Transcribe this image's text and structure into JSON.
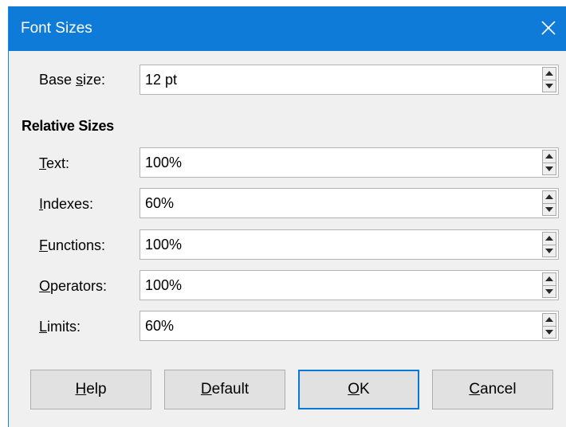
{
  "dialog": {
    "title": "Font Sizes",
    "base_size": {
      "label_pre": "Base ",
      "label_key": "s",
      "label_post": "ize:",
      "value": "12 pt"
    },
    "relative_heading": "Relative Sizes",
    "fields": [
      {
        "key": "T",
        "rest": "ext:",
        "value": "100%"
      },
      {
        "key": "I",
        "rest": "ndexes:",
        "value": "60%"
      },
      {
        "key": "F",
        "rest": "unctions:",
        "value": "100%"
      },
      {
        "key": "O",
        "rest": "perators:",
        "value": "100%"
      },
      {
        "key": "L",
        "rest": "imits:",
        "value": "60%"
      }
    ],
    "buttons": {
      "help": {
        "key": "H",
        "rest": "elp"
      },
      "default": {
        "key": "D",
        "rest": "efault"
      },
      "ok": {
        "key": "O",
        "rest": "K"
      },
      "cancel": {
        "key": "C",
        "rest": "ancel"
      }
    }
  },
  "colors": {
    "titlebar": "#0f7bd8",
    "dialog_bg": "#f0f0f0",
    "focus_border": "#0a78d7"
  },
  "icons": {
    "close": "close-icon",
    "spin_up": "spin-up-icon",
    "spin_down": "spin-down-icon"
  }
}
